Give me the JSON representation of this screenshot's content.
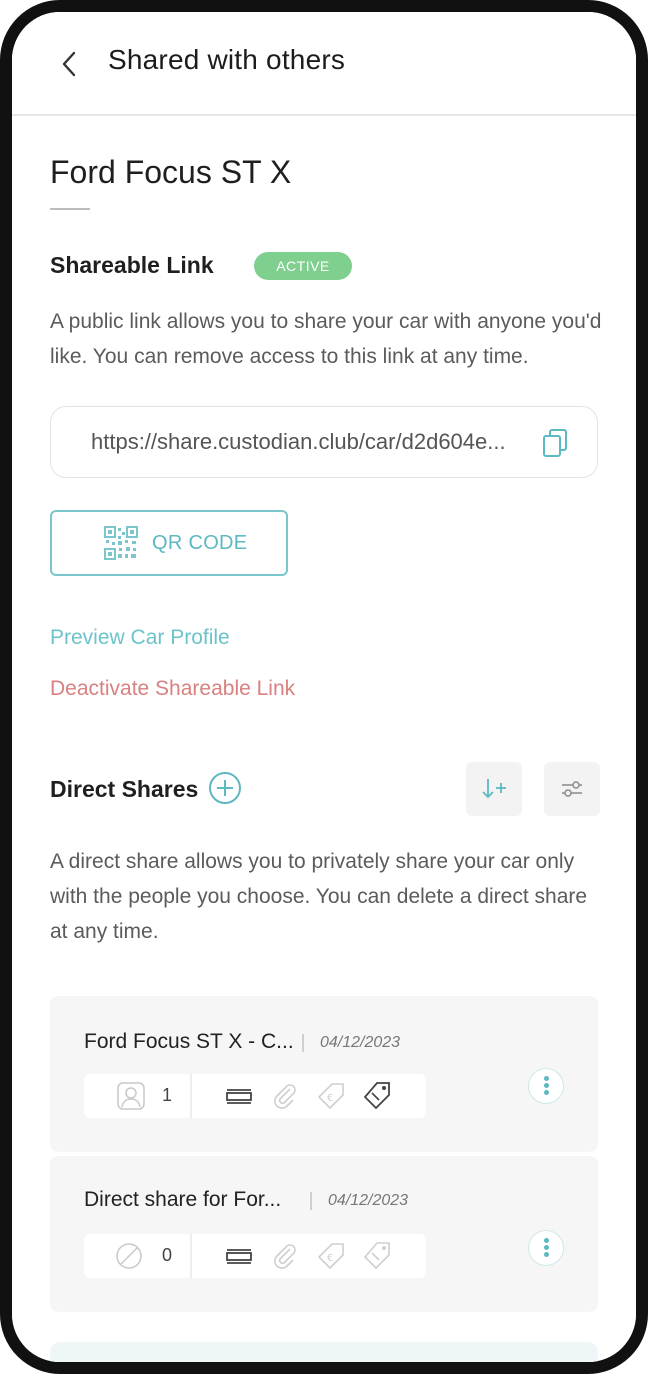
{
  "header": {
    "title": "Shared with others",
    "back_icon": "chevron-left-icon"
  },
  "car": {
    "name": "Ford Focus ST X"
  },
  "shareable_link": {
    "label": "Shareable Link",
    "status": "ACTIVE",
    "status_color": "#7fcf8f",
    "description": "A public link allows you to share your car with anyone you'd like. You can remove access to this link at any time.",
    "url": "https://share.custodian.club/car/d2d604e...",
    "copy_icon": "copy-icon",
    "qr_button_label": "QR CODE",
    "preview_link": "Preview Car Profile",
    "deactivate_link": "Deactivate Shareable Link"
  },
  "direct_shares": {
    "label": "Direct Shares",
    "add_icon": "plus-circle-icon",
    "sort_icon": "sort-add-icon",
    "filter_icon": "filter-icon",
    "description": "A direct share allows you to privately share your car only with the people you choose. You can delete a direct share at any time.",
    "items": [
      {
        "title": "Ford Focus ST X - C...",
        "date": "04/12/2023",
        "count": "1",
        "recipient_icon": "avatar-icon"
      },
      {
        "title": "Direct share for For...",
        "date": "04/12/2023",
        "count": "0",
        "recipient_icon": "no-recipient-icon"
      }
    ]
  },
  "colors": {
    "accent": "#5cb8c1",
    "danger": "#d98080",
    "text": "#222222"
  }
}
